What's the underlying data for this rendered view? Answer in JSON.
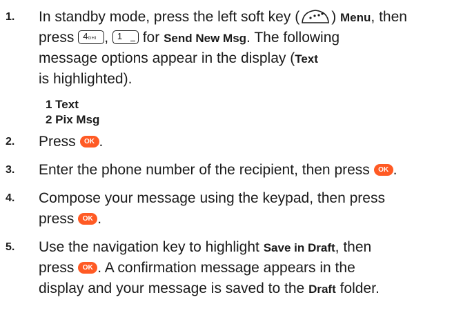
{
  "steps": [
    {
      "n": "1.",
      "l1a": "In standby mode, press the left soft key (",
      "l1b": ") ",
      "menu": "Menu",
      "l1c": ", then",
      "l2a": "press",
      "key4": "4",
      "key4sub": "GHI",
      "l2b": ",",
      "key1": "1",
      "l2c": " for ",
      "sendnew": "Send New Msg",
      "l2d": ". The following",
      "l3": "message options appear in the display (",
      "textword": "Text",
      "l4": "is highlighted).",
      "opt1": "1 Text",
      "opt2": "2 Pix Msg"
    },
    {
      "n": "2.",
      "a": "Press",
      "b": "."
    },
    {
      "n": "3.",
      "a": "Enter the phone number of the recipient, then press",
      "b": "."
    },
    {
      "n": "4.",
      "a": "Compose your message using the keypad, then press",
      "a2": "press",
      "b": "."
    },
    {
      "n": "5.",
      "a": "Use the navigation key to highlight ",
      "save": "Save in Draft",
      "a2": ", then",
      "p": "press",
      "b": ". A confirmation message appears in the",
      "c": "display and your message is saved to the ",
      "draft": "Draft",
      "d": " folder."
    }
  ],
  "ok_label": "OK",
  "colors": {
    "ok_key": "#ff5a24",
    "text": "#1a1a1a"
  }
}
